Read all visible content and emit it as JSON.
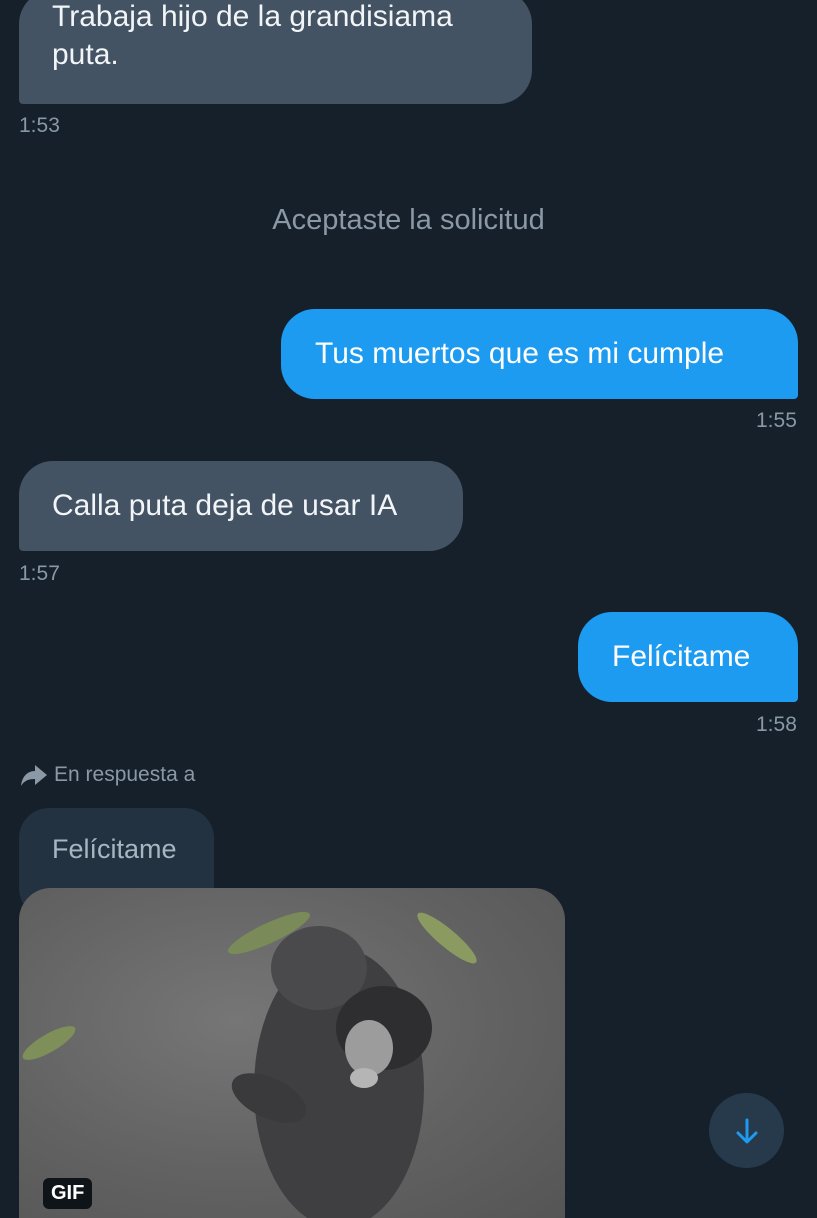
{
  "messages": {
    "m1": {
      "text": "Trabaja hijo de la grandisiama puta.",
      "time": "1:53"
    },
    "system_notice": "Aceptaste la solicitud",
    "m2": {
      "text": "Tus muertos que es mi cumple",
      "time": "1:55"
    },
    "m3": {
      "text": "Calla puta deja de usar IA",
      "time": "1:57"
    },
    "m4": {
      "text": "Felícitame",
      "time": "1:58"
    },
    "reply": {
      "context_label": "En respuesta a",
      "quoted_text": "Felícitame",
      "media_badge": "GIF"
    }
  },
  "colors": {
    "background": "#15202b",
    "incoming_bubble": "#435363",
    "outgoing_bubble": "#1d9bf0",
    "timestamp": "#8899a6"
  },
  "icons": {
    "reply_context": "reply-arrow-icon",
    "scroll_down": "arrow-down-icon"
  }
}
